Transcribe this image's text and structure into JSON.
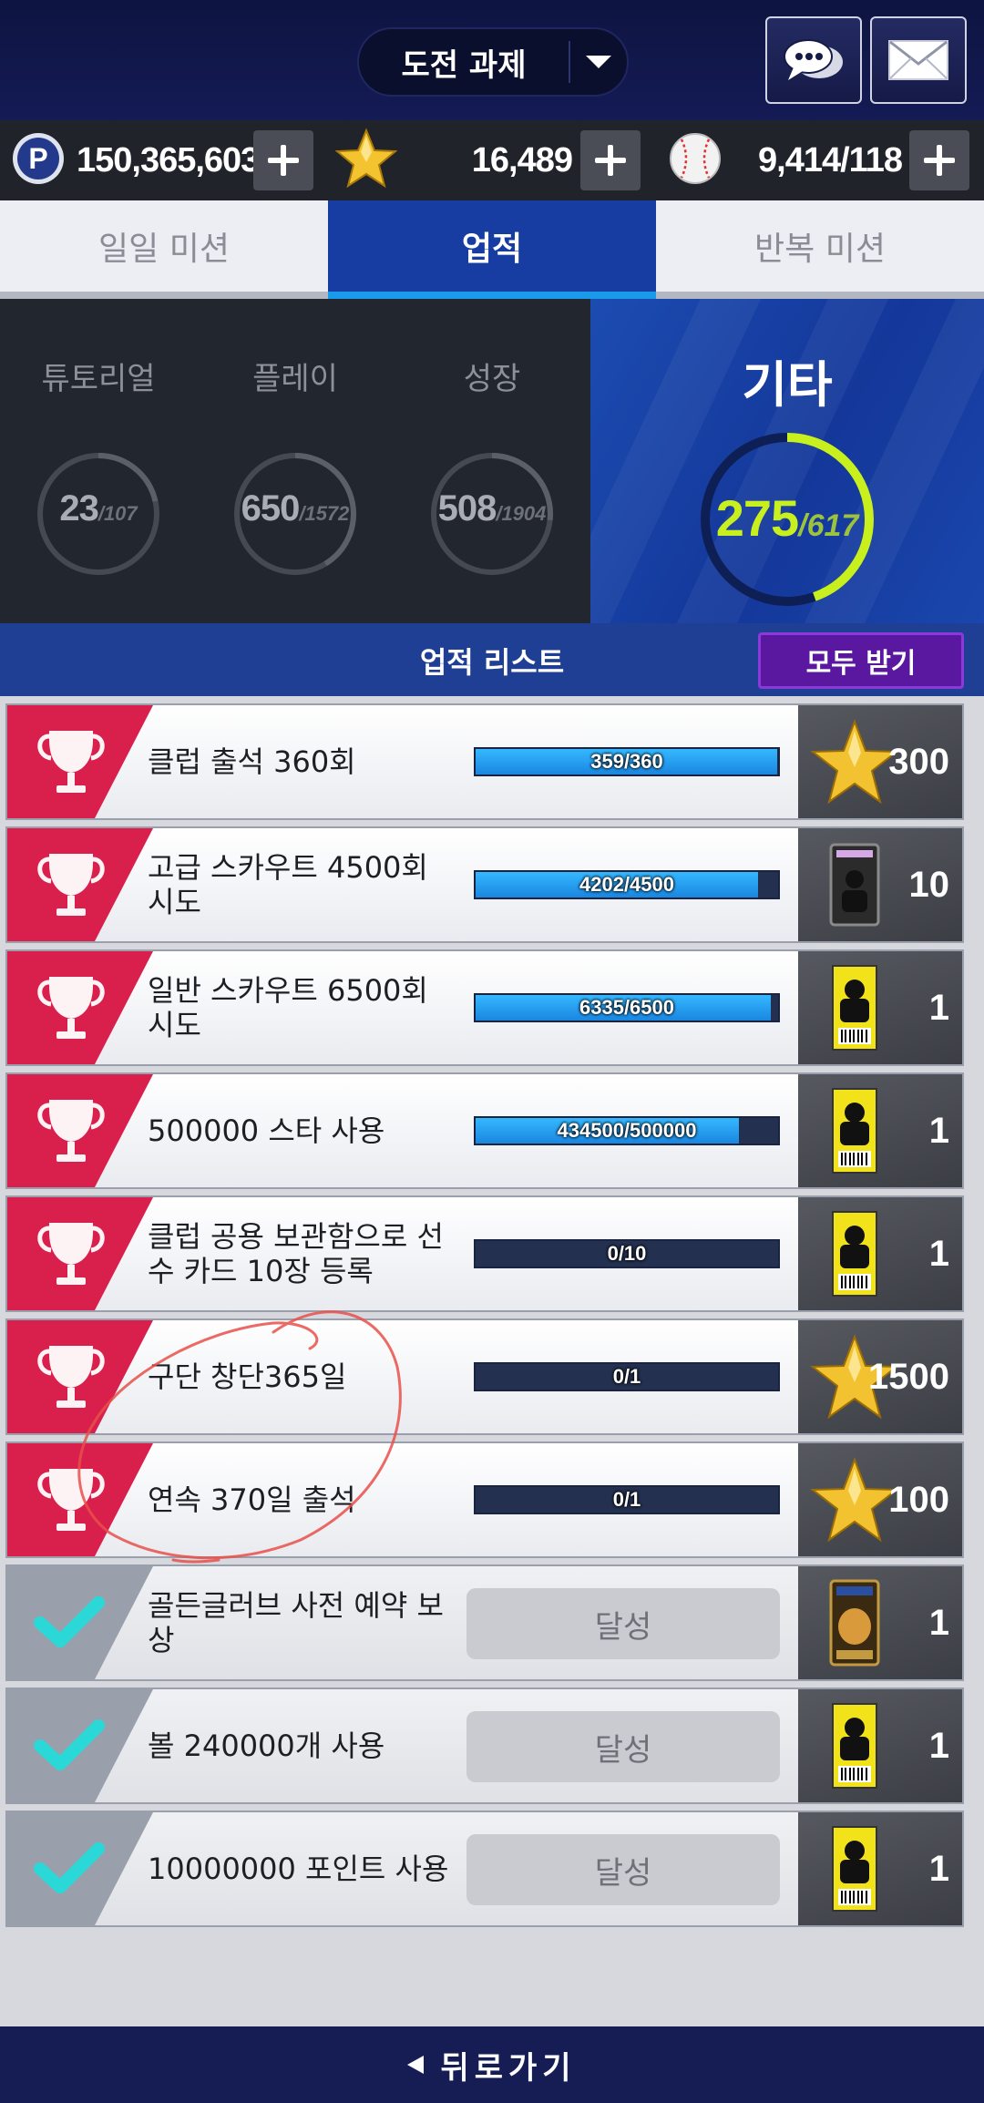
{
  "header": {
    "title": "도전 과제"
  },
  "currency": {
    "points": "150,365,603",
    "stars": "16,489",
    "balls": "9,414/118"
  },
  "tabs": [
    {
      "label": "일일 미션",
      "active": false
    },
    {
      "label": "업적",
      "active": true
    },
    {
      "label": "반복 미션",
      "active": false
    }
  ],
  "categories": [
    {
      "label": "튜토리얼",
      "current": "23",
      "total": "/107",
      "progress": 0.215
    },
    {
      "label": "플레이",
      "current": "650",
      "total": "/1572",
      "progress": 0.413
    },
    {
      "label": "성장",
      "current": "508",
      "total": "/1904",
      "progress": 0.267
    },
    {
      "label": "기타",
      "current": "275",
      "total": "/617",
      "progress": 0.446
    }
  ],
  "list": {
    "title": "업적 리스트",
    "claim_all_label": "모두 받기"
  },
  "achievements": [
    {
      "name": "클럽 출석 360회",
      "progress_text": "359/360",
      "progress": 0.997,
      "reward": "star",
      "qty": "300",
      "done": false
    },
    {
      "name": "고급 스카우트 4500회 시도",
      "progress_text": "4202/4500",
      "progress": 0.934,
      "reward": "card",
      "qty": "10",
      "done": false
    },
    {
      "name": "일반 스카우트 6500회 시도",
      "progress_text": "6335/6500",
      "progress": 0.975,
      "reward": "ticket",
      "qty": "1",
      "done": false
    },
    {
      "name": "500000 스타 사용",
      "progress_text": "434500/500000",
      "progress": 0.869,
      "reward": "ticket",
      "qty": "1",
      "done": false
    },
    {
      "name": "클럽 공용 보관함으로 선수 카드 10장 등록",
      "progress_text": "0/10",
      "progress": 0,
      "reward": "ticket",
      "qty": "1",
      "done": false
    },
    {
      "name": "구단 창단365일",
      "progress_text": "0/1",
      "progress": 0,
      "reward": "star",
      "qty": "1500",
      "done": false
    },
    {
      "name": "연속 370일 출석",
      "progress_text": "0/1",
      "progress": 0,
      "reward": "star",
      "qty": "100",
      "done": false
    },
    {
      "name": "골든글러브 사전 예약 보상",
      "done_label": "달성",
      "reward": "glove-card",
      "qty": "1",
      "done": true
    },
    {
      "name": "볼 240000개 사용",
      "done_label": "달성",
      "reward": "ticket",
      "qty": "1",
      "done": true
    },
    {
      "name": "10000000 포인트 사용",
      "done_label": "달성",
      "reward": "ticket",
      "qty": "1",
      "done": true
    }
  ],
  "footer": {
    "back_label": "뒤로가기"
  },
  "colors": {
    "accent_blue": "#173da3",
    "progress_lime": "#c8f01e",
    "badge_red": "#d9204d",
    "check_cyan": "#2ad8d8",
    "claim_purple": "#5a17a0"
  }
}
